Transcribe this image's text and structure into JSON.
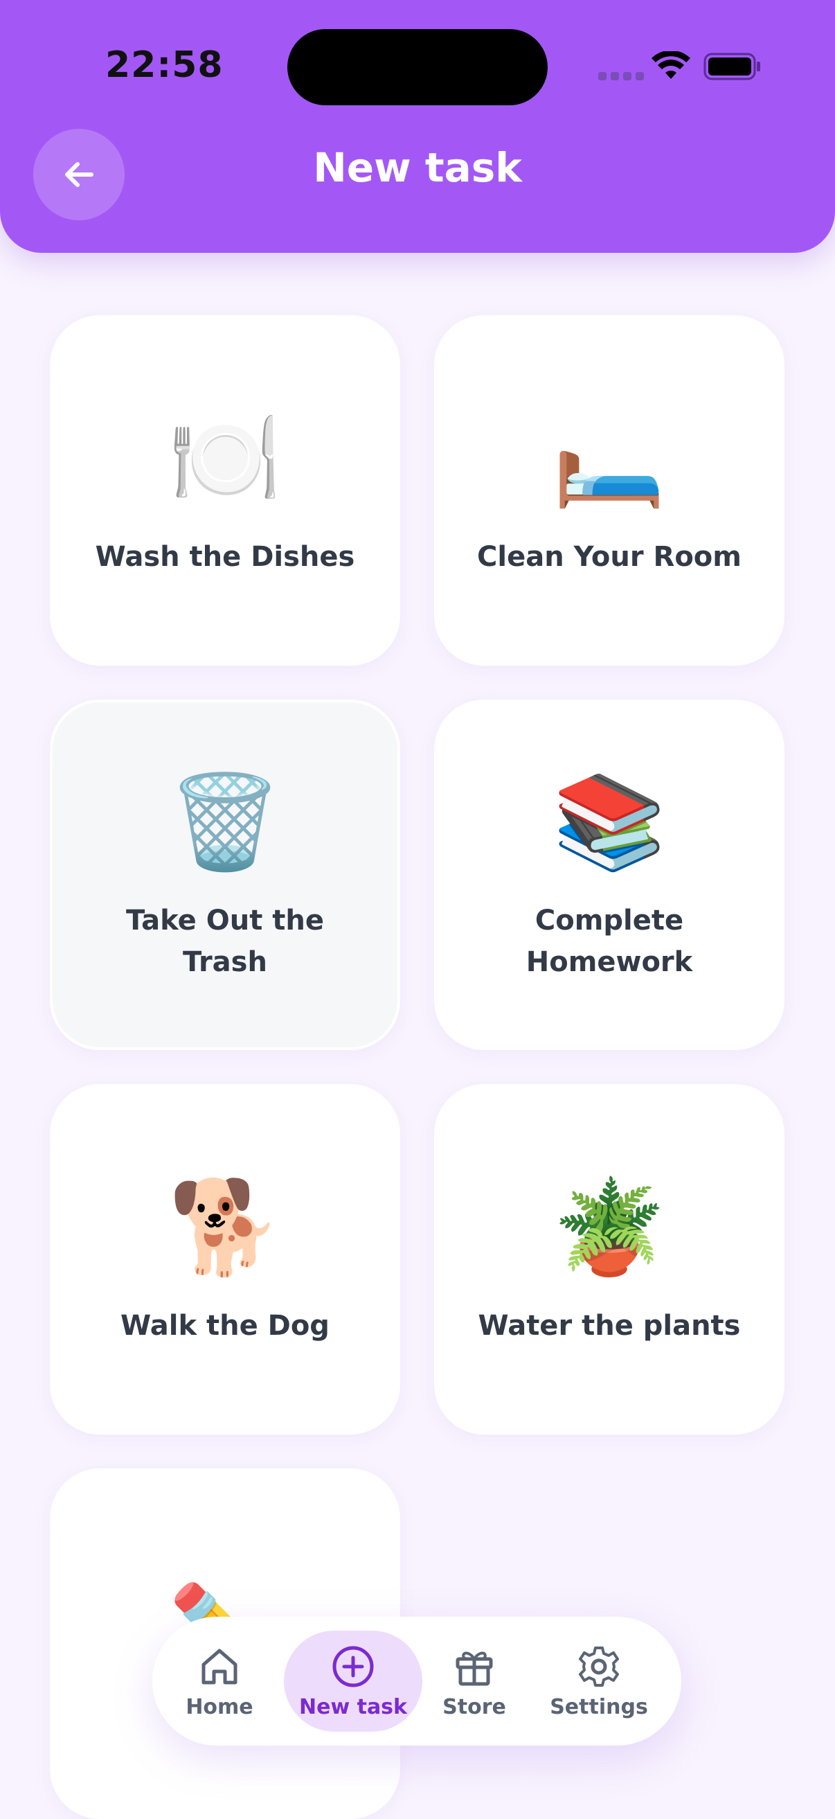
{
  "status_bar": {
    "time": "22:58"
  },
  "header": {
    "title": "New task"
  },
  "tasks": [
    {
      "emoji": "🍽️",
      "label": "Wash the Dishes"
    },
    {
      "emoji": "🛏️",
      "label": "Clean Your Room"
    },
    {
      "emoji": "🗑️",
      "label": "Take Out the Trash",
      "selected": true
    },
    {
      "emoji": "📚",
      "label": "Complete Homework"
    },
    {
      "emoji": "🐕",
      "label": "Walk the Dog"
    },
    {
      "emoji": "🪴",
      "label": "Water the plants"
    },
    {
      "emoji": "✏️",
      "label": ""
    }
  ],
  "bottom_nav": {
    "items": [
      {
        "label": "Home",
        "icon": "home-icon"
      },
      {
        "label": "New task",
        "icon": "plus-circle-icon",
        "active": true
      },
      {
        "label": "Store",
        "icon": "gift-icon"
      },
      {
        "label": "Settings",
        "icon": "gear-icon"
      }
    ]
  },
  "colors": {
    "header": "#a358f6",
    "background": "#f8f3fe",
    "accent": "#7b2bd0",
    "active_tab_bg": "#eedcfd"
  }
}
